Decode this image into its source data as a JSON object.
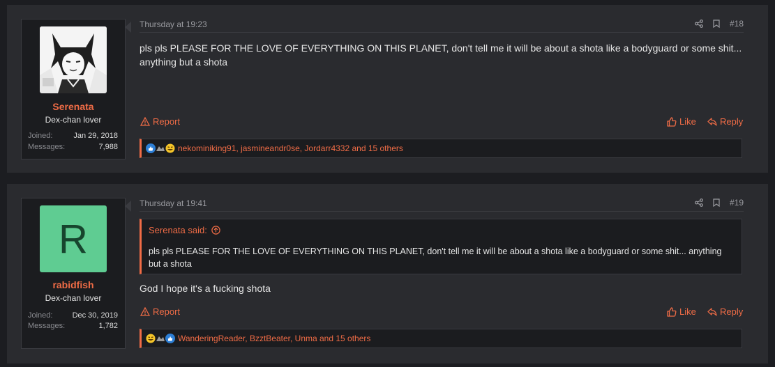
{
  "posts": [
    {
      "user": {
        "name": "Serenata",
        "title": "Dex-chan lover",
        "joined_label": "Joined:",
        "joined": "Jan 29, 2018",
        "messages_label": "Messages:",
        "messages": "7,988"
      },
      "time": "Thursday at 19:23",
      "number": "#18",
      "content": "pls pls PLEASE FOR THE LOVE OF EVERYTHING ON THIS PLANET, don't tell me it will be about a shota like a bodyguard or some shit... anything but a shota",
      "report_label": "Report",
      "like_label": "Like",
      "reply_label": "Reply",
      "reactions_text": "nekominiking91, jasmineandr0se, Jordarr4332 and 15 others"
    },
    {
      "user": {
        "name": "rabidfish",
        "title": "Dex-chan lover",
        "avatar_letter": "R",
        "avatar_color": "#5fcc92",
        "joined_label": "Joined:",
        "joined": "Dec 30, 2019",
        "messages_label": "Messages:",
        "messages": "1,782"
      },
      "time": "Thursday at 19:41",
      "number": "#19",
      "quote": {
        "author": "Serenata said:",
        "text": "pls pls PLEASE FOR THE LOVE OF EVERYTHING ON THIS PLANET, don't tell me it will be about a shota like a bodyguard or some shit... anything but a shota"
      },
      "content": "God I hope it's a fucking shota",
      "report_label": "Report",
      "like_label": "Like",
      "reply_label": "Reply",
      "reactions_text": "WanderingReader, BzztBeater, Unma and 15 others"
    }
  ],
  "colors": {
    "accent": "#f06c46",
    "panel": "#2a2b2f",
    "background": "#1c1d21"
  }
}
